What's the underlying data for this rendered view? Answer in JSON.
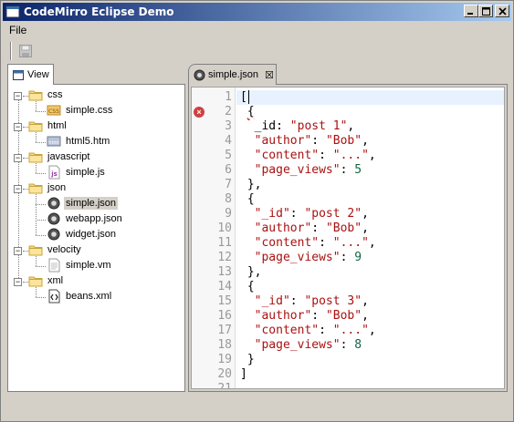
{
  "window": {
    "title": "CodeMirro Eclipse Demo",
    "buttons": {
      "minimize": "_",
      "maximize": "□",
      "close": "×"
    }
  },
  "menu": {
    "items": [
      "File"
    ]
  },
  "toolbar": {
    "save_icon": "save-disk-icon"
  },
  "view": {
    "tab_label": "View",
    "tree": [
      {
        "type": "folder",
        "label": "css",
        "depth": 0
      },
      {
        "type": "file",
        "label": "simple.css",
        "icon": "css",
        "depth": 1
      },
      {
        "type": "folder",
        "label": "html",
        "depth": 0
      },
      {
        "type": "file",
        "label": "html5.htm",
        "icon": "html",
        "depth": 1
      },
      {
        "type": "folder",
        "label": "javascript",
        "depth": 0
      },
      {
        "type": "file",
        "label": "simple.js",
        "icon": "js",
        "depth": 1
      },
      {
        "type": "folder",
        "label": "json",
        "depth": 0
      },
      {
        "type": "file",
        "label": "simple.json",
        "icon": "json",
        "depth": 1,
        "selected": true
      },
      {
        "type": "file",
        "label": "webapp.json",
        "icon": "json",
        "depth": 1
      },
      {
        "type": "file",
        "label": "widget.json",
        "icon": "json",
        "depth": 1
      },
      {
        "type": "folder",
        "label": "velocity",
        "depth": 0
      },
      {
        "type": "file",
        "label": "simple.vm",
        "icon": "text",
        "depth": 1
      },
      {
        "type": "folder",
        "label": "xml",
        "depth": 0
      },
      {
        "type": "file",
        "label": "beans.xml",
        "icon": "xml",
        "depth": 1
      }
    ]
  },
  "editor": {
    "tab_label": "simple.json",
    "tab_close": "☒",
    "active_line": 1,
    "error_line": 2,
    "lines": [
      [
        [
          "punc",
          "["
        ]
      ],
      [
        [
          "punc",
          " "
        ],
        [
          "squig",
          "{"
        ]
      ],
      [
        [
          "punc",
          "  _id: "
        ],
        [
          "str",
          "\"post 1\""
        ],
        [
          "punc",
          ","
        ]
      ],
      [
        [
          "punc",
          "  "
        ],
        [
          "str",
          "\"author\""
        ],
        [
          "punc",
          ": "
        ],
        [
          "str",
          "\"Bob\""
        ],
        [
          "punc",
          ","
        ]
      ],
      [
        [
          "punc",
          "  "
        ],
        [
          "str",
          "\"content\""
        ],
        [
          "punc",
          ": "
        ],
        [
          "str",
          "\"...\""
        ],
        [
          "punc",
          ","
        ]
      ],
      [
        [
          "punc",
          "  "
        ],
        [
          "str",
          "\"page_views\""
        ],
        [
          "punc",
          ": "
        ],
        [
          "num",
          "5"
        ]
      ],
      [
        [
          "punc",
          " },"
        ]
      ],
      [
        [
          "punc",
          " {"
        ]
      ],
      [
        [
          "punc",
          "  "
        ],
        [
          "str",
          "\"_id\""
        ],
        [
          "punc",
          ": "
        ],
        [
          "str",
          "\"post 2\""
        ],
        [
          "punc",
          ","
        ]
      ],
      [
        [
          "punc",
          "  "
        ],
        [
          "str",
          "\"author\""
        ],
        [
          "punc",
          ": "
        ],
        [
          "str",
          "\"Bob\""
        ],
        [
          "punc",
          ","
        ]
      ],
      [
        [
          "punc",
          "  "
        ],
        [
          "str",
          "\"content\""
        ],
        [
          "punc",
          ": "
        ],
        [
          "str",
          "\"...\""
        ],
        [
          "punc",
          ","
        ]
      ],
      [
        [
          "punc",
          "  "
        ],
        [
          "str",
          "\"page_views\""
        ],
        [
          "punc",
          ": "
        ],
        [
          "num",
          "9"
        ]
      ],
      [
        [
          "punc",
          " },"
        ]
      ],
      [
        [
          "punc",
          " {"
        ]
      ],
      [
        [
          "punc",
          "  "
        ],
        [
          "str",
          "\"_id\""
        ],
        [
          "punc",
          ": "
        ],
        [
          "str",
          "\"post 3\""
        ],
        [
          "punc",
          ","
        ]
      ],
      [
        [
          "punc",
          "  "
        ],
        [
          "str",
          "\"author\""
        ],
        [
          "punc",
          ": "
        ],
        [
          "str",
          "\"Bob\""
        ],
        [
          "punc",
          ","
        ]
      ],
      [
        [
          "punc",
          "  "
        ],
        [
          "str",
          "\"content\""
        ],
        [
          "punc",
          ": "
        ],
        [
          "str",
          "\"...\""
        ],
        [
          "punc",
          ","
        ]
      ],
      [
        [
          "punc",
          "  "
        ],
        [
          "str",
          "\"page_views\""
        ],
        [
          "punc",
          ": "
        ],
        [
          "num",
          "8"
        ]
      ],
      [
        [
          "punc",
          " }"
        ]
      ],
      [
        [
          "punc",
          "]"
        ]
      ],
      [
        [
          "punc",
          ""
        ]
      ]
    ]
  }
}
